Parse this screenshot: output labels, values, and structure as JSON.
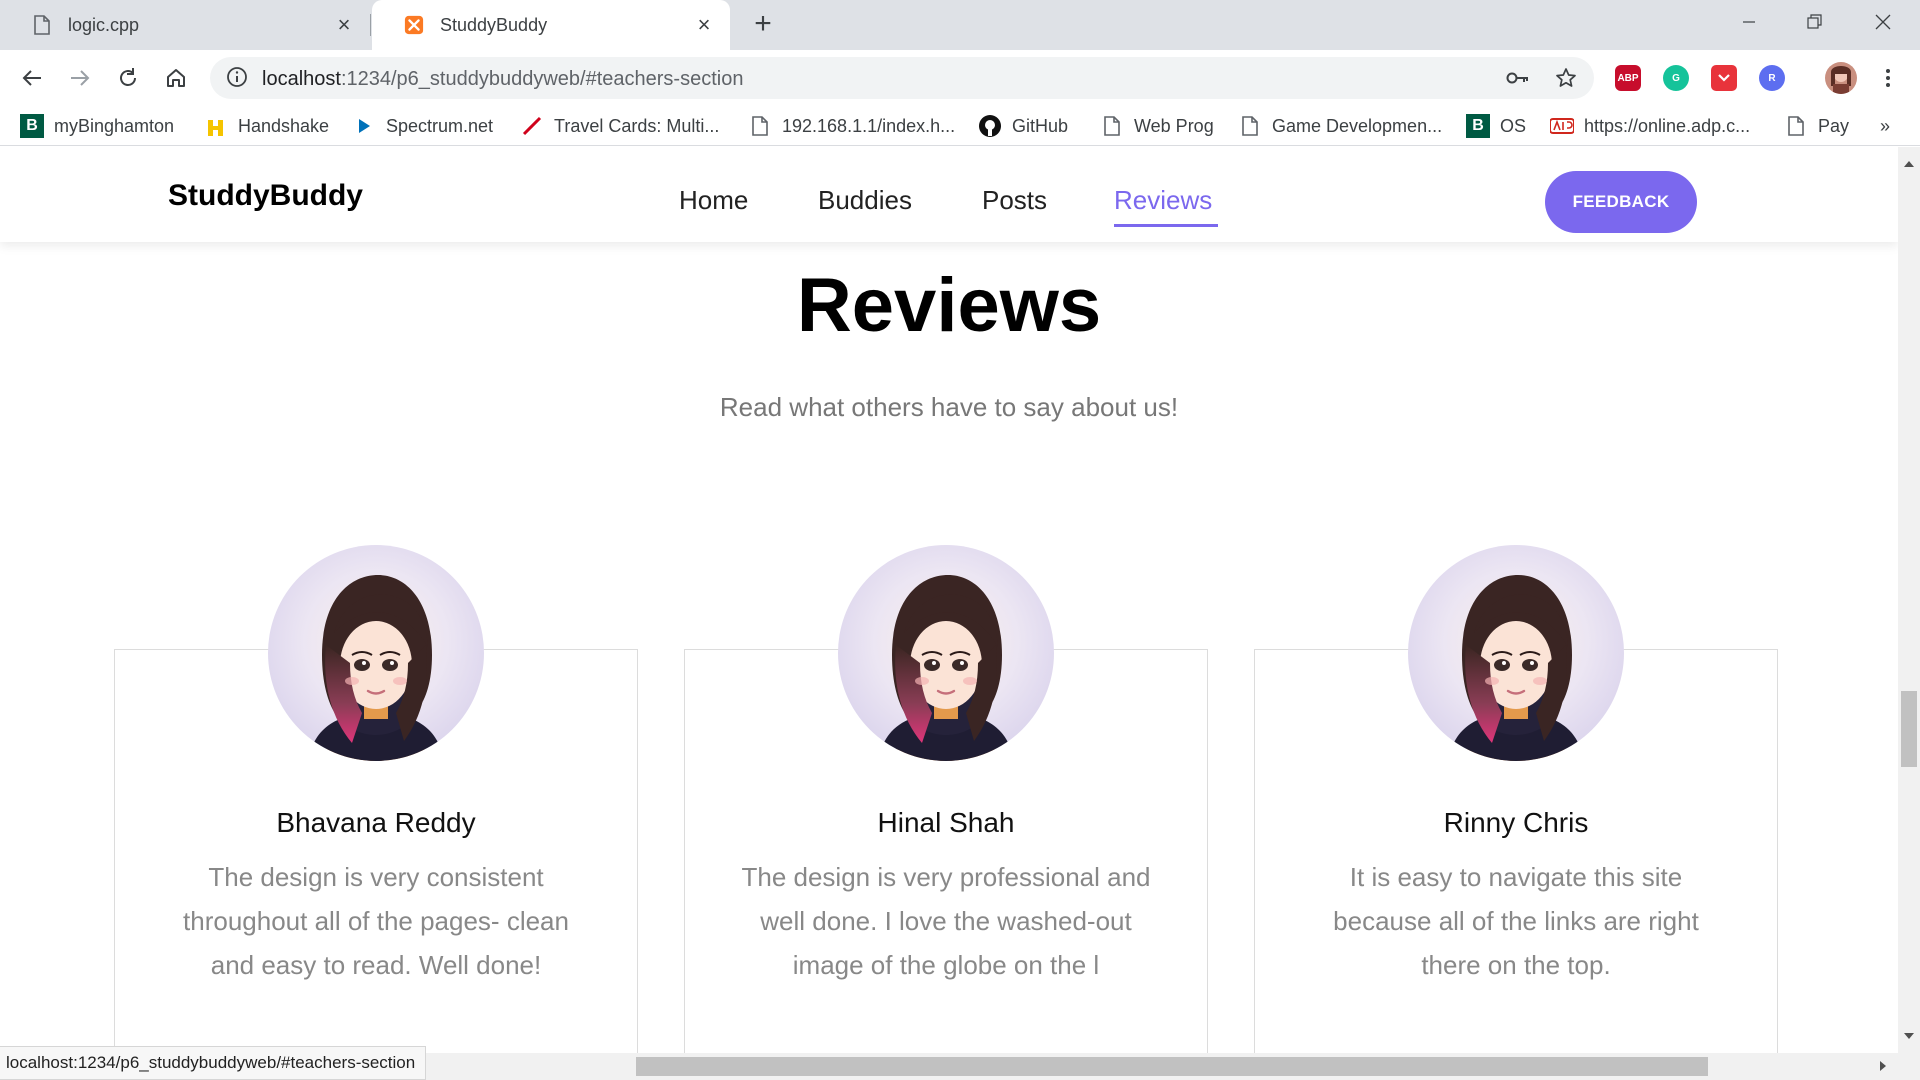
{
  "browser": {
    "tabs": [
      {
        "title": "logic.cpp",
        "icon": "file-icon",
        "active": false
      },
      {
        "title": "StuddyBuddy",
        "icon": "xampp-icon",
        "active": true
      }
    ],
    "address": {
      "host": "localhost",
      "path": ":1234/p6_studdybuddyweb/#teachers-section"
    },
    "bookmarks": [
      {
        "label": "myBinghamton",
        "icon": "binghamton-b-icon"
      },
      {
        "label": "Handshake",
        "icon": "handshake-icon"
      },
      {
        "label": "Spectrum.net",
        "icon": "spectrum-play-icon"
      },
      {
        "label": "Travel Cards: Multi...",
        "icon": "travel-check-icon"
      },
      {
        "label": "192.168.1.1/index.h...",
        "icon": "file-icon"
      },
      {
        "label": "GitHub",
        "icon": "github-icon"
      },
      {
        "label": "Web Prog",
        "icon": "file-icon"
      },
      {
        "label": "Game Developmen...",
        "icon": "file-icon"
      },
      {
        "label": "OS",
        "icon": "binghamton-b-icon"
      },
      {
        "label": "https://online.adp.c...",
        "icon": "adp-icon"
      },
      {
        "label": "Pay",
        "icon": "file-icon"
      }
    ],
    "bookmarks_more": "»",
    "extensions": [
      {
        "label": "ABP",
        "color": "#c70d2c"
      },
      {
        "label": "G",
        "color": "#15c39a"
      },
      {
        "label": "",
        "color": "#e8333b"
      },
      {
        "label": "R",
        "color": "#5d6ef0"
      }
    ],
    "status_url": "localhost:1234/p6_studdybuddyweb/#teachers-section"
  },
  "site": {
    "brand": "StuddyBuddy",
    "nav": [
      "Home",
      "Buddies",
      "Posts",
      "Reviews"
    ],
    "active_nav": "Reviews",
    "feedback_label": "FEEDBACK",
    "accent_color": "#7b68ee"
  },
  "reviews": {
    "title": "Reviews",
    "subtitle": "Read what others have to say about us!",
    "items": [
      {
        "name": "Bhavana Reddy",
        "text": "The design is very consistent throughout all of the pages- clean and easy to read. Well done!"
      },
      {
        "name": "Hinal Shah",
        "text": "The design is very professional and well done. I love the washed-out image of the globe on the l"
      },
      {
        "name": "Rinny Chris",
        "text": "It is easy to navigate this site because all of the links are right there on the top."
      }
    ]
  }
}
